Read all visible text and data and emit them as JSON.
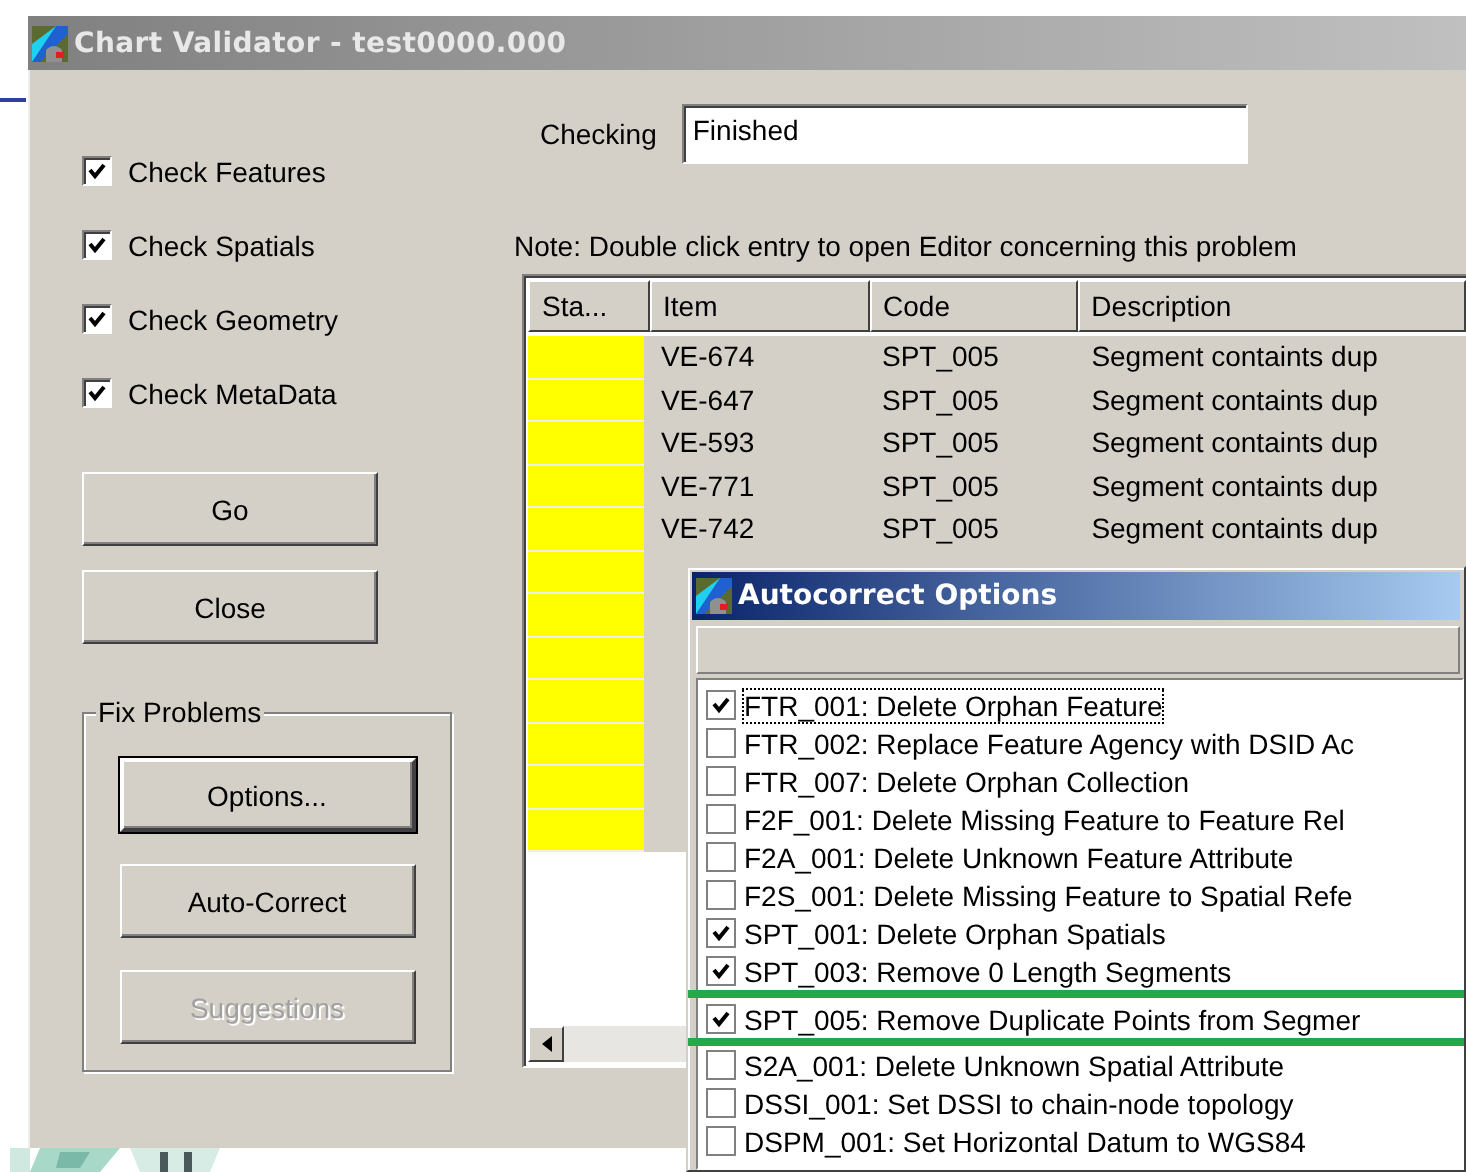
{
  "window": {
    "title": "Chart Validator - test0000.000"
  },
  "checks": [
    {
      "label": "Check Features",
      "checked": true
    },
    {
      "label": "Check Spatials",
      "checked": true
    },
    {
      "label": "Check Geometry",
      "checked": true
    },
    {
      "label": "Check MetaData",
      "checked": true
    }
  ],
  "buttons": [
    {
      "label": "Go",
      "disabled": false
    },
    {
      "label": "Close",
      "disabled": false
    }
  ],
  "fix_problems": {
    "title": "Fix Problems",
    "buttons": [
      {
        "label": "Options...",
        "disabled": false,
        "default": true
      },
      {
        "label": "Auto-Correct",
        "disabled": false,
        "default": false
      },
      {
        "label": "Suggestions",
        "disabled": true,
        "default": false
      }
    ]
  },
  "checking": {
    "label": "Checking",
    "value": "Finished"
  },
  "note": "Note: Double click entry to open Editor concerning this problem",
  "table": {
    "columns": [
      "Sta...",
      "Item",
      "Code",
      "Description"
    ],
    "rows": [
      {
        "color": "#ffff00",
        "item": "VE-674",
        "code": "SPT_005",
        "description": "Segment containts dup"
      },
      {
        "color": "#ffff00",
        "item": "VE-647",
        "code": "SPT_005",
        "description": "Segment containts dup"
      },
      {
        "color": "#ffff00",
        "item": "VE-593",
        "code": "SPT_005",
        "description": "Segment containts dup"
      },
      {
        "color": "#ffff00",
        "item": "VE-771",
        "code": "SPT_005",
        "description": "Segment containts dup"
      },
      {
        "color": "#ffff00",
        "item": "VE-742",
        "code": "SPT_005",
        "description": "Segment containts dup"
      },
      {
        "color": "#ffff00"
      },
      {
        "color": "#ffff00"
      },
      {
        "color": "#ffff00"
      },
      {
        "color": "#ffff00"
      },
      {
        "color": "#ffff00"
      },
      {
        "color": "#ffff00"
      },
      {
        "color": "#ffff00"
      }
    ]
  },
  "autocorrect": {
    "title": "Autocorrect Options",
    "options": [
      {
        "label": "FTR_001: Delete Orphan Feature",
        "checked": true,
        "focused": true,
        "highlighted": false
      },
      {
        "label": "FTR_002: Replace Feature Agency with DSID Ac",
        "checked": false,
        "focused": false,
        "highlighted": false
      },
      {
        "label": "FTR_007: Delete Orphan Collection",
        "checked": false,
        "focused": false,
        "highlighted": false
      },
      {
        "label": "F2F_001: Delete Missing Feature to Feature Rel",
        "checked": false,
        "focused": false,
        "highlighted": false
      },
      {
        "label": "F2A_001: Delete Unknown Feature Attribute",
        "checked": false,
        "focused": false,
        "highlighted": false
      },
      {
        "label": "F2S_001: Delete Missing Feature to Spatial Refe",
        "checked": false,
        "focused": false,
        "highlighted": false
      },
      {
        "label": "SPT_001: Delete Orphan Spatials",
        "checked": true,
        "focused": false,
        "highlighted": false
      },
      {
        "label": "SPT_003: Remove 0 Length Segments",
        "checked": true,
        "focused": false,
        "highlighted": false
      },
      {
        "label": "SPT_005: Remove Duplicate Points from Segmer",
        "checked": true,
        "focused": false,
        "highlighted": true
      },
      {
        "label": "S2A_001: Delete Unknown Spatial Attribute",
        "checked": false,
        "focused": false,
        "highlighted": false
      },
      {
        "label": "DSSI_001: Set DSSI to chain-node topology",
        "checked": false,
        "focused": false,
        "highlighted": false
      },
      {
        "label": "DSPM_001: Set Horizontal Datum to WGS84",
        "checked": false,
        "focused": false,
        "highlighted": false
      }
    ]
  }
}
